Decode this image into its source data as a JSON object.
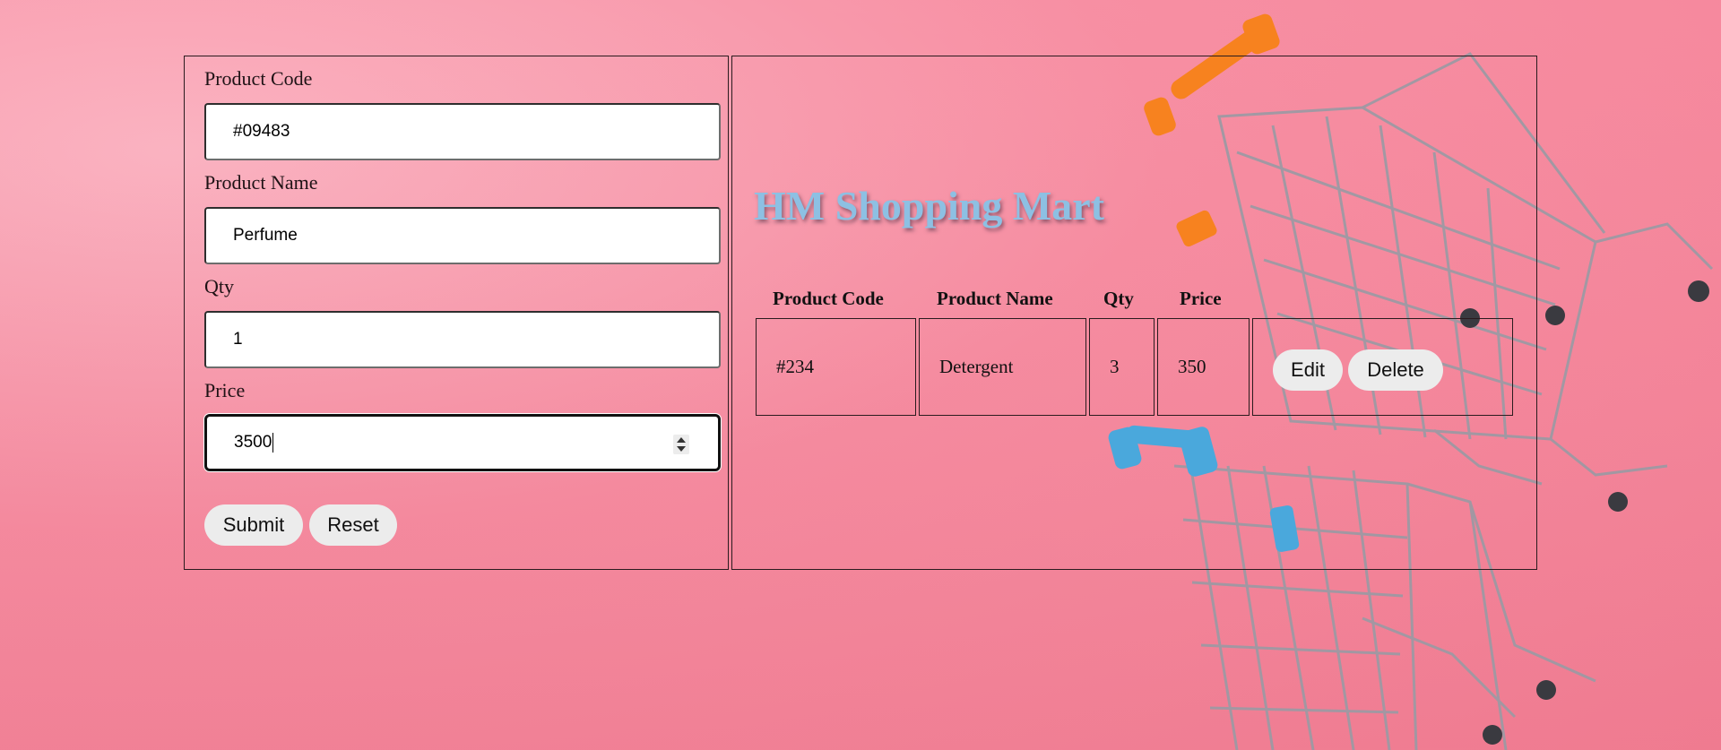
{
  "form": {
    "code_label": "Product Code",
    "code_value": "#09483",
    "name_label": "Product Name",
    "name_value": "Perfume",
    "qty_label": "Qty",
    "qty_value": "1",
    "price_label": "Price",
    "price_value": "3500",
    "submit_label": "Submit",
    "reset_label": "Reset"
  },
  "main": {
    "title": "HM Shopping Mart",
    "table": {
      "headers": [
        "Product Code",
        "Product Name",
        "Qty",
        "Price"
      ],
      "rows": [
        {
          "code": "#234",
          "name": "Detergent",
          "qty": "3",
          "price": "350",
          "edit_label": "Edit",
          "delete_label": "Delete"
        }
      ]
    }
  },
  "theme": {
    "background": "#f47d93",
    "title_color": "#8dc0e3",
    "cart_handle_orange": "#f7821f",
    "cart_handle_blue": "#4aa8dc"
  }
}
